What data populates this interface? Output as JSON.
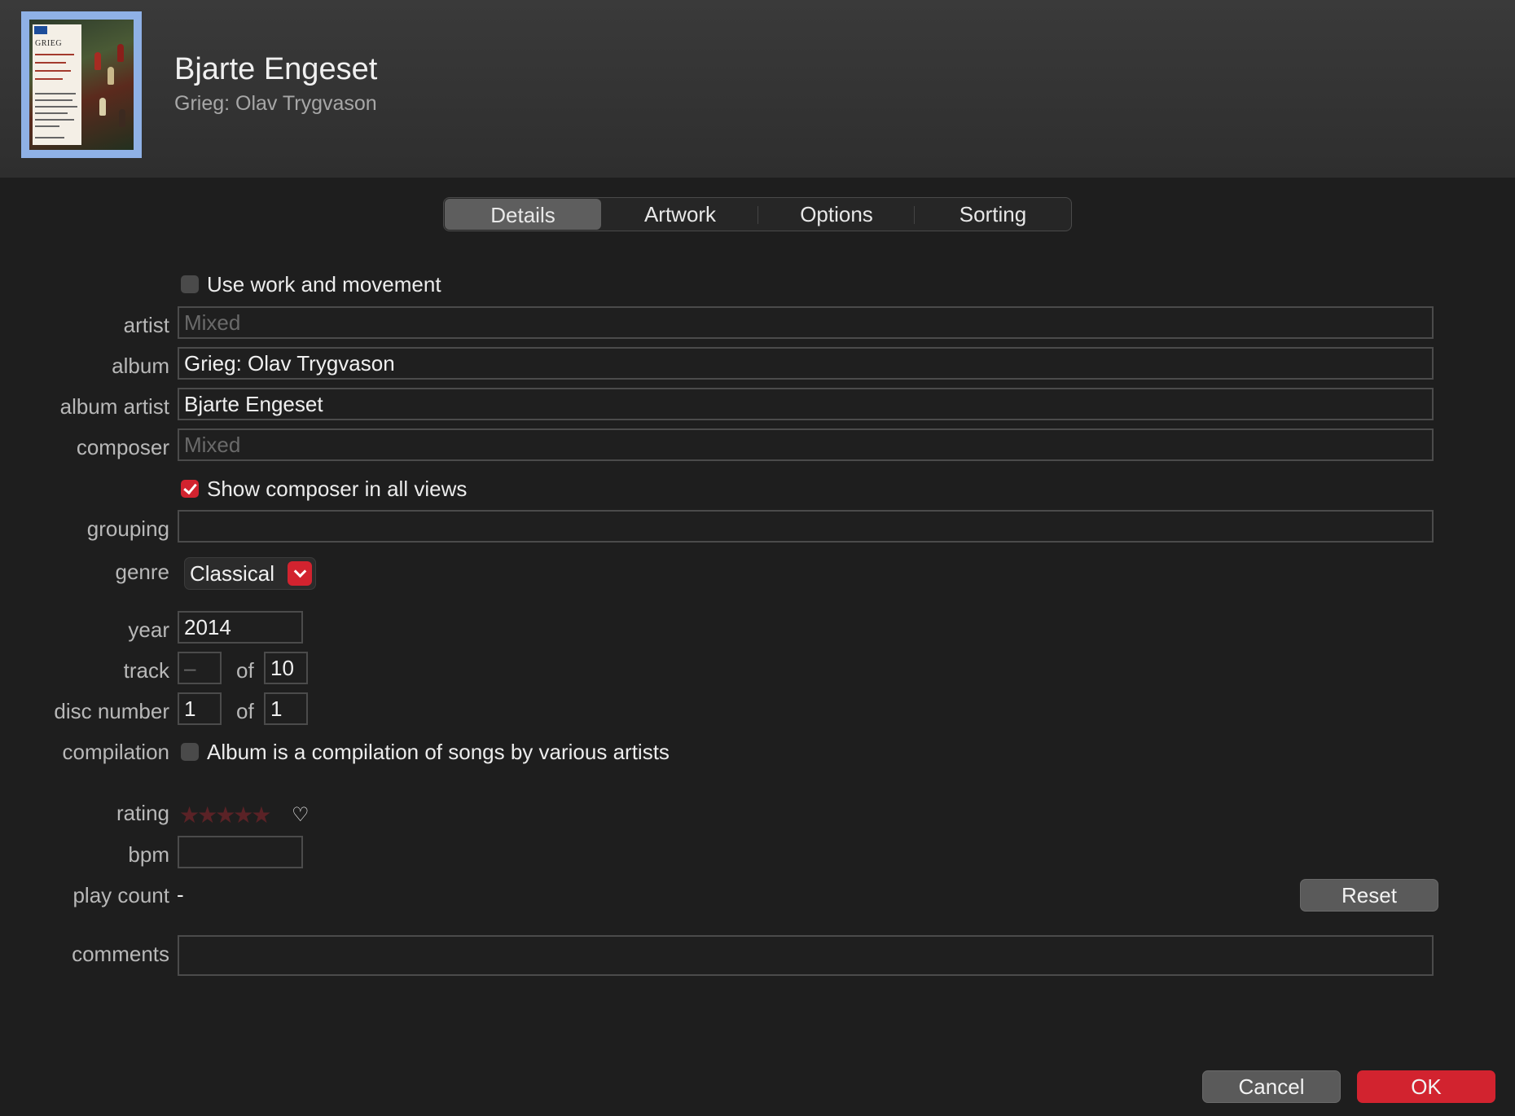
{
  "header": {
    "title": "Bjarte Engeset",
    "subtitle": "Grieg: Olav Trygvason",
    "artwork": {
      "cover_title": "GRIEG"
    }
  },
  "tabs": [
    {
      "label": "Details",
      "active": true
    },
    {
      "label": "Artwork",
      "active": false
    },
    {
      "label": "Options",
      "active": false
    },
    {
      "label": "Sorting",
      "active": false
    }
  ],
  "form": {
    "use_work": {
      "label": "Use work and movement",
      "checked": false
    },
    "artist": {
      "label": "artist",
      "value": "",
      "placeholder": "Mixed"
    },
    "album": {
      "label": "album",
      "value": "Grieg: Olav Trygvason"
    },
    "album_artist": {
      "label": "album artist",
      "value": "Bjarte Engeset"
    },
    "composer": {
      "label": "composer",
      "value": "",
      "placeholder": "Mixed"
    },
    "show_composer": {
      "label": "Show composer in all views",
      "checked": true
    },
    "grouping": {
      "label": "grouping",
      "value": ""
    },
    "genre": {
      "label": "genre",
      "value": "Classical"
    },
    "year": {
      "label": "year",
      "value": "2014"
    },
    "track": {
      "label": "track",
      "value": "",
      "placeholder": "–",
      "of_label": "of",
      "total": "10"
    },
    "disc": {
      "label": "disc number",
      "value": "1",
      "of_label": "of",
      "total": "1"
    },
    "compilation": {
      "label": "compilation",
      "text": "Album is a compilation of songs by various artists",
      "checked": false
    },
    "rating": {
      "label": "rating",
      "stars": "★★★★★",
      "value": 0,
      "heart": "♡"
    },
    "bpm": {
      "label": "bpm",
      "value": ""
    },
    "play_count": {
      "label": "play count",
      "value": "-",
      "reset_label": "Reset"
    },
    "comments": {
      "label": "comments",
      "value": ""
    }
  },
  "footer": {
    "cancel_label": "Cancel",
    "ok_label": "OK"
  },
  "colors": {
    "accent": "#d2232f",
    "background": "#1e1e1e",
    "header": "#333333"
  }
}
